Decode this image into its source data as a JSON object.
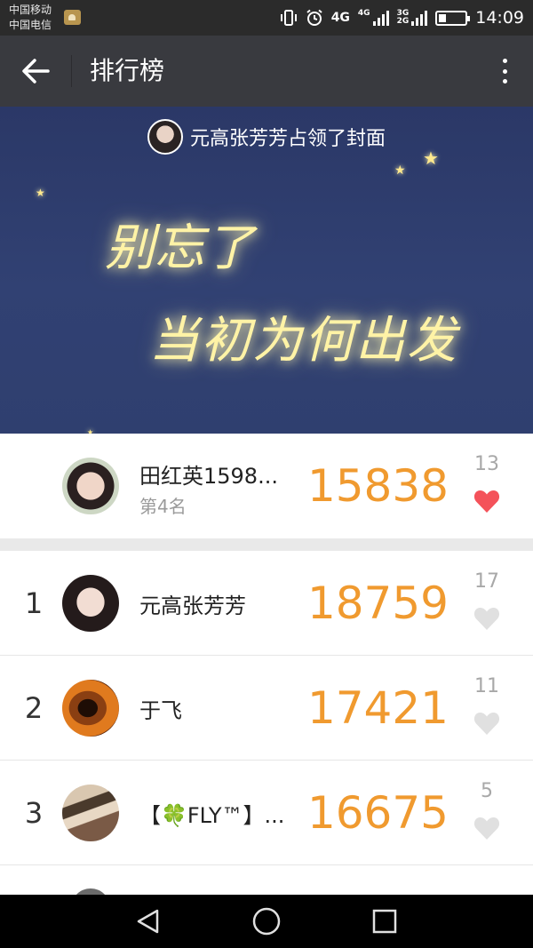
{
  "status_bar": {
    "carrier_1": "中国移动",
    "carrier_2": "中国电信",
    "network_1": "4G",
    "network_2": "4G",
    "network_3": "3G",
    "network_4": "2G",
    "time": "14:09"
  },
  "app_bar": {
    "title": "排行榜",
    "back_icon": "arrow-left-icon",
    "more_icon": "more-vertical-icon"
  },
  "cover": {
    "owner_text": "元高张芳芳占领了封面",
    "line_1": "别忘了",
    "line_2": "当初为何出发"
  },
  "my_rank": {
    "name": "田红英1598...",
    "rank_text": "第4名",
    "steps": "15838",
    "likes": "13",
    "liked": true
  },
  "rankings": [
    {
      "rank": "1",
      "name": "元高张芳芳",
      "steps": "18759",
      "likes": "17",
      "liked": false
    },
    {
      "rank": "2",
      "name": "于飞",
      "steps": "17421",
      "likes": "11",
      "liked": false
    },
    {
      "rank": "3",
      "name": "【🍀FLY™】...",
      "steps": "16675",
      "likes": "5",
      "liked": false
    }
  ],
  "colors": {
    "app_bar": "#393a3f",
    "steps": "#f09a2f",
    "heart_liked": "#f4525a",
    "heart_default": "#e0e0e0"
  }
}
